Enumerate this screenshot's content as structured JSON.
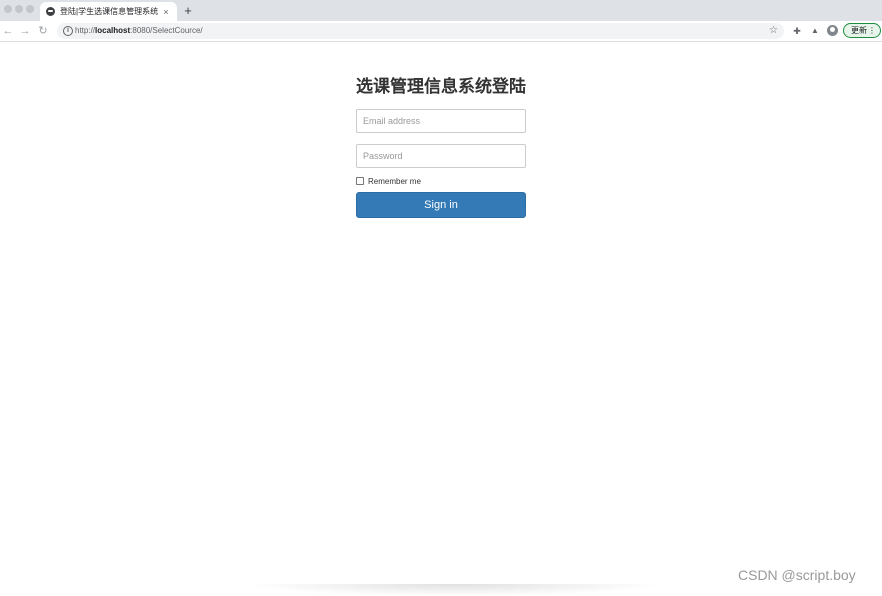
{
  "browser": {
    "tab": {
      "title": "登陆|学生选课信息管理系统",
      "close": "×"
    },
    "new_tab": "+",
    "nav": {
      "back": "←",
      "forward": "→",
      "reload": "↻"
    },
    "url": {
      "scheme": "http://",
      "host": "localhost",
      "rest": ":8080/SelectCource/"
    },
    "star": "☆",
    "update_label": "更新",
    "menu": "⋮"
  },
  "login": {
    "heading": "选课管理信息系统登陆",
    "email_placeholder": "Email address",
    "password_placeholder": "Password",
    "remember_label": "Remember me",
    "signin_label": "Sign in"
  },
  "watermark": "CSDN @script.boy",
  "colors": {
    "primary_button": "#337ab7",
    "update_border": "#1e8e3e"
  }
}
